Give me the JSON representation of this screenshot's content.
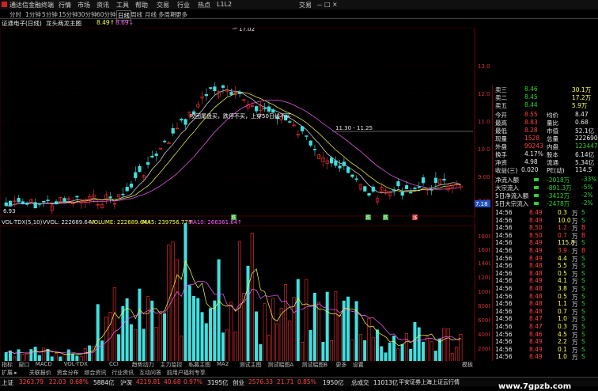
{
  "titlebar": {
    "app_name": "通达信金融终端",
    "menus": [
      "行情",
      "市场",
      "资讯",
      "工具",
      "帮助",
      "交易",
      "行业",
      "热点",
      "L1L2"
    ],
    "trade_label": "交易",
    "win_controls": [
      "－",
      "□",
      "×"
    ]
  },
  "periodbar": {
    "items": [
      "分时",
      "1分钟",
      "5分钟",
      "15分钟",
      "30分钟",
      "60分钟",
      "日线",
      "周线",
      "月线",
      "多周期",
      "更多"
    ]
  },
  "infobar": {
    "stock": "证通电子(日线)",
    "indicator": "龙头两龙主图",
    "v1": "8.49↑",
    "v2": "8.69↓",
    "v3": "8.39"
  },
  "chart": {
    "price_axis": [
      "13.00",
      "12.00",
      "11.00",
      "10.00",
      "9.00",
      "8.00",
      "7.18"
    ],
    "high_label": "17.02",
    "low_label": "6.93",
    "annotation": "咬团尾盘买，跌停不买，上穿50日线不买",
    "ref_line_label": "11.30 - 11.25",
    "vol_header": {
      "vol_title": "VOL-TDX(5,10)",
      "vvol": "VVOL: 222689.64↑",
      "volume": "VOLUME: 222689.64↑",
      "ma5": "MA5: 239756.77↑",
      "ma10": "MA10: 266361.64↑"
    },
    "vol_axis": [
      "18000",
      "16000",
      "14000",
      "12000",
      "10000",
      "8000",
      "6000",
      "4000",
      "2000",
      "×10"
    ],
    "date_marks": [
      "2021年",
      "12",
      "2021/12/24/五",
      "2",
      "3",
      "4",
      "5",
      "6"
    ],
    "tag_labels": [
      "跌",
      "跌",
      "跌",
      "涨"
    ]
  },
  "orderbook": {
    "sell": [
      {
        "label": "卖三",
        "price": "8.46",
        "vol": "30.1万"
      },
      {
        "label": "卖二",
        "price": "8.45",
        "vol": "17.2万"
      },
      {
        "label": "卖五",
        "price": "8.44",
        "vol": "5.9万"
      }
    ],
    "quote": [
      {
        "l1": "今开",
        "v1": "8.55",
        "l2": "均价",
        "v2": "8.47"
      },
      {
        "l1": "最高",
        "v1": "8.83",
        "l2": "量比",
        "v2": "0.68"
      },
      {
        "l1": "最低",
        "v1": "8.28",
        "l2": "市值",
        "v2": "52.1亿"
      },
      {
        "l1": "现量",
        "v1": "1528",
        "l2": "总量",
        "v2": "222690"
      },
      {
        "l1": "外盘",
        "v1": "99243",
        "l2": "内盘",
        "v2": "123447"
      },
      {
        "l1": "换手",
        "v1": "4.17%",
        "l2": "股本",
        "v2": "6.14亿"
      },
      {
        "l1": "净资",
        "v1": "4.98",
        "l2": "流通",
        "v2": "5.34亿"
      },
      {
        "l1": "收益(三)",
        "v1": "0.020",
        "l2": "PE(动)",
        "v2": "114.5"
      }
    ],
    "flows": [
      {
        "label": "净流入额",
        "value": "-2018万",
        "pct": "-33%"
      },
      {
        "label": "大宗流入",
        "value": "-891.3万",
        "pct": "-5%"
      },
      {
        "label": "5日净流入额",
        "value": "-3412万",
        "pct": "-2%"
      },
      {
        "label": "5日大宗流入",
        "value": "-2478万",
        "pct": "-2%"
      }
    ],
    "tape": [
      {
        "t": "14:56",
        "p": "8.49",
        "v": "0.3",
        "s": "万",
        "d": "5"
      },
      {
        "t": "14:56",
        "p": "8.49",
        "v": "10.0",
        "s": "万",
        "d": "S"
      },
      {
        "t": "14:56",
        "p": "8.50",
        "v": "1.2",
        "s": "万",
        "d": "B"
      },
      {
        "t": "14:56",
        "p": "8.50",
        "v": "0.7",
        "s": "万",
        "d": "B"
      },
      {
        "t": "14:56",
        "p": "8.49",
        "v": "115.8",
        "s": "万",
        "d": "S"
      },
      {
        "t": "14:56",
        "p": "8.49",
        "v": "3.9",
        "s": "万",
        "d": "B"
      },
      {
        "t": "14:56",
        "p": "8.49",
        "v": "4.4",
        "s": "万",
        "d": "S"
      },
      {
        "t": "14:56",
        "p": "8.48",
        "v": "5.5",
        "s": "万",
        "d": "S"
      },
      {
        "t": "14:56",
        "p": "8.48",
        "v": "0.5",
        "s": "万",
        "d": "S"
      },
      {
        "t": "14:56",
        "p": "8.49",
        "v": "4.1",
        "s": "万",
        "d": "S"
      },
      {
        "t": "14:56",
        "p": "8.48",
        "v": "3.8",
        "s": "万",
        "d": "S"
      },
      {
        "t": "14:56",
        "p": "8.48",
        "v": "0.5",
        "s": "万",
        "d": "S"
      },
      {
        "t": "14:56",
        "p": "8.48",
        "v": "1.1",
        "s": "万",
        "d": "S"
      },
      {
        "t": "14:56",
        "p": "8.48",
        "v": "0.7",
        "s": "万",
        "d": "S"
      },
      {
        "t": "14:56",
        "p": "8.47",
        "v": "1.0",
        "s": "万",
        "d": "S"
      },
      {
        "t": "14:56",
        "p": "8.47",
        "v": "0.3",
        "s": "万",
        "d": "S"
      },
      {
        "t": "14:56",
        "p": "8.46",
        "v": "4.5",
        "s": "万",
        "d": "S"
      },
      {
        "t": "14:56",
        "p": "8.49",
        "v": "2.2",
        "s": "万",
        "d": "S"
      },
      {
        "t": "14:56",
        "p": "8.49",
        "v": "0.1",
        "s": "万",
        "d": "S"
      },
      {
        "t": "14:56",
        "p": "8.49",
        "v": "1.0",
        "s": "万",
        "d": "S"
      },
      {
        "t": "14:56",
        "p": "8.49",
        "v": "0.5",
        "s": "万",
        "d": "S"
      }
    ]
  },
  "bottomtabs": {
    "row1": [
      "指标",
      "窗口",
      "MACD",
      "VOL-TDX",
      "CCI",
      "趋势动力",
      "主力监控",
      "私募主图",
      "MA2",
      "测试主图",
      "测试幅图A",
      "测试幅图B",
      "更多",
      "设置"
    ],
    "row2": [
      "扩展 ▸",
      "关联报价",
      "资金分布",
      "综合资讯",
      "行业资讯",
      "互动问答",
      "前用户福利专享"
    ],
    "right": "模板"
  },
  "statusbar": {
    "sh_label": "上证",
    "sh_val": "3263.79",
    "sh_chg": "22.03",
    "sh_pct": "0.68%",
    "sh_amt": "5884亿",
    "hs_label": "沪深",
    "hs_val": "4219.81",
    "hs_chg": "40.68",
    "hs_pct": "0.97%",
    "hs_amt": "3195亿",
    "cy_label": "创业",
    "cy_val": "2576.33",
    "cy_chg": "21.71",
    "cy_pct": "0.85%",
    "cy_amt": "1950亿",
    "total_label": "总成交",
    "total_val": "11013亿",
    "broker": "平安证券上海上证云行情"
  },
  "watermark": "www.7gpzb.com"
}
